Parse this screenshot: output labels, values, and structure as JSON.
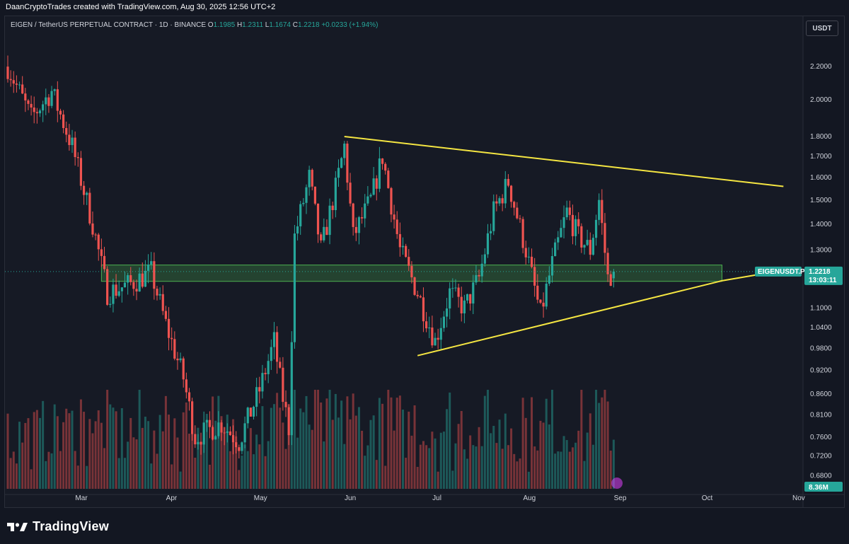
{
  "header": {
    "credit": "DaanCryptoTrades created with TradingView.com, Aug 30, 2025 12:56 UTC+2"
  },
  "symbol": {
    "name": "EIGEN / TetherUS PERPETUAL CONTRACT · 1D · BINANCE",
    "o_label": "O",
    "o": "1.1985",
    "h_label": "H",
    "h": "1.2311",
    "l_label": "L",
    "l": "1.1674",
    "c_label": "C",
    "c": "1.2218",
    "change": "+0.0233 (+1.94%)"
  },
  "currency_button": "USDT",
  "price_tag": {
    "ticker": "EIGENUSDT.P",
    "price": "1.2218",
    "countdown": "13:03:11"
  },
  "volume_tag": "8.36M",
  "brand": {
    "name": "TradingView",
    "icon": "tradingview-logo-icon"
  },
  "colors": {
    "up": "#26a69a",
    "down": "#ef5350",
    "trendline": "#f5e642",
    "zone": "#4caf50",
    "background": "#161a25"
  },
  "chart_data": {
    "type": "candlestick",
    "title": "EIGEN / TetherUS PERPETUAL CONTRACT · 1D · BINANCE",
    "y_scale": "log",
    "ylim": [
      0.655,
      2.32
    ],
    "y_ticks": [
      "2.2000",
      "2.0000",
      "1.8000",
      "1.7000",
      "1.6000",
      "1.5000",
      "1.4000",
      "1.3000",
      "1.1000",
      "1.0400",
      "0.9800",
      "0.9200",
      "0.8600",
      "0.8100",
      "0.7600",
      "0.7200",
      "0.6800"
    ],
    "x_ticks": [
      "Mar",
      "Apr",
      "May",
      "Jun",
      "Jul",
      "Aug",
      "Sep",
      "Oct",
      "Nov"
    ],
    "x_range_days": [
      "2025-02-04",
      "2025-11-01"
    ],
    "last_price": 1.2218,
    "candles_key_points": [
      {
        "date": "2025-02-04",
        "close": 2.2
      },
      {
        "date": "2025-02-12",
        "close": 1.9
      },
      {
        "date": "2025-02-19",
        "close": 2.05
      },
      {
        "date": "2025-02-26",
        "close": 1.75
      },
      {
        "date": "2025-03-05",
        "close": 1.4
      },
      {
        "date": "2025-03-10",
        "close": 1.15
      },
      {
        "date": "2025-03-18",
        "close": 1.18
      },
      {
        "date": "2025-03-25",
        "close": 1.22
      },
      {
        "date": "2025-03-30",
        "close": 1.05
      },
      {
        "date": "2025-04-05",
        "close": 0.9
      },
      {
        "date": "2025-04-09",
        "close": 0.76
      },
      {
        "date": "2025-04-18",
        "close": 0.79
      },
      {
        "date": "2025-04-24",
        "close": 0.75
      },
      {
        "date": "2025-05-01",
        "close": 0.87
      },
      {
        "date": "2025-05-06",
        "close": 1.0
      },
      {
        "date": "2025-05-09",
        "close": 0.85
      },
      {
        "date": "2025-05-11",
        "close": 0.78
      },
      {
        "date": "2025-05-13",
        "close": 1.35
      },
      {
        "date": "2025-05-18",
        "close": 1.6
      },
      {
        "date": "2025-05-22",
        "close": 1.3
      },
      {
        "date": "2025-05-27",
        "close": 1.55
      },
      {
        "date": "2025-05-30",
        "close": 1.75
      },
      {
        "date": "2025-06-02",
        "close": 1.35
      },
      {
        "date": "2025-06-08",
        "close": 1.5
      },
      {
        "date": "2025-06-12",
        "close": 1.7
      },
      {
        "date": "2025-06-18",
        "close": 1.3
      },
      {
        "date": "2025-06-24",
        "close": 1.15
      },
      {
        "date": "2025-06-30",
        "close": 1.0
      },
      {
        "date": "2025-07-05",
        "close": 1.15
      },
      {
        "date": "2025-07-10",
        "close": 1.1
      },
      {
        "date": "2025-07-15",
        "close": 1.2
      },
      {
        "date": "2025-07-20",
        "close": 1.45
      },
      {
        "date": "2025-07-25",
        "close": 1.58
      },
      {
        "date": "2025-07-31",
        "close": 1.3
      },
      {
        "date": "2025-08-05",
        "close": 1.08
      },
      {
        "date": "2025-08-09",
        "close": 1.25
      },
      {
        "date": "2025-08-14",
        "close": 1.45
      },
      {
        "date": "2025-08-18",
        "close": 1.35
      },
      {
        "date": "2025-08-22",
        "close": 1.3
      },
      {
        "date": "2025-08-25",
        "close": 1.5
      },
      {
        "date": "2025-08-28",
        "close": 1.2
      },
      {
        "date": "2025-08-30",
        "close": 1.2218
      }
    ],
    "annotations": {
      "upper_trendline": [
        {
          "date": "2025-05-30",
          "price": 1.8
        },
        {
          "date": "2025-10-27",
          "price": 1.56
        }
      ],
      "lower_trendline": [
        {
          "date": "2025-06-24",
          "price": 0.96
        },
        {
          "date": "2025-10-06",
          "price": 1.19
        }
      ],
      "support_zone": {
        "from": "2025-03-08",
        "to": "2025-10-06",
        "top": 1.245,
        "bottom": 1.188
      }
    },
    "volume_last": "8.36M",
    "grid": false
  }
}
